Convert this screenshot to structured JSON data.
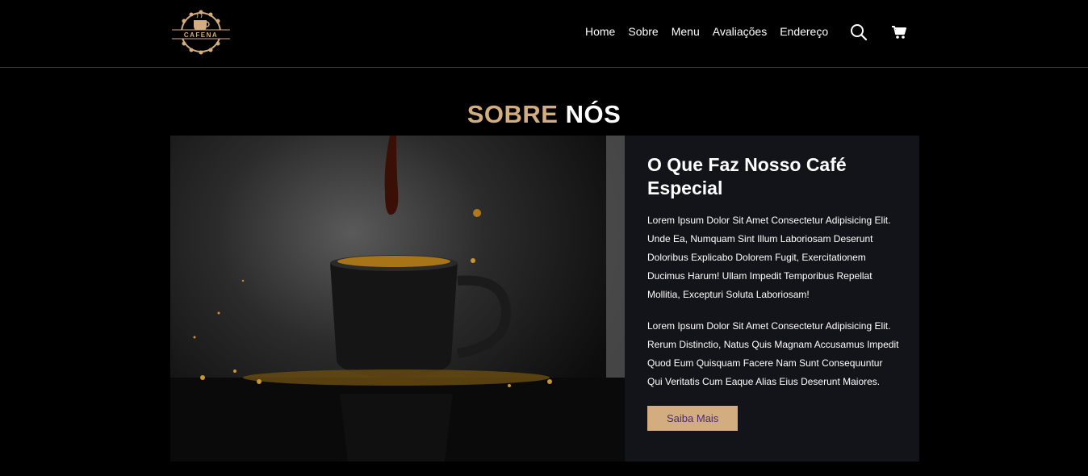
{
  "brand": {
    "logo_text": "CAFENA"
  },
  "nav": {
    "items": [
      "Home",
      "Sobre",
      "Menu",
      "Avaliações",
      "Endereço"
    ]
  },
  "icons": {
    "search": "search-icon",
    "cart": "cart-icon"
  },
  "colors": {
    "accent": "#d3ad7f",
    "card_bg": "#13131a",
    "button_text": "#4b2a70"
  },
  "about": {
    "title_accent": "SOBRE",
    "title_rest": "NÓS",
    "heading": "O Que Faz Nosso Café Especial",
    "paragraph1": "Lorem Ipsum Dolor Sit Amet Consectetur Adipisicing Elit. Unde Ea, Numquam Sint Illum Laboriosam Deserunt Doloribus Explicabo Dolorem Fugit, Exercitationem Ducimus Harum! Ullam Impedit Temporibus Repellat Mollitia, Excepturi Soluta Laboriosam!",
    "paragraph2": "Lorem Ipsum Dolor Sit Amet Consectetur Adipisicing Elit. Rerum Distinctio, Natus Quis Magnam Accusamus Impedit Quod Eum Quisquam Facere Nam Sunt Consequuntur Qui Veritatis Cum Eaque Alias Eius Deserunt Maiores.",
    "button_label": "Saiba Mais"
  }
}
